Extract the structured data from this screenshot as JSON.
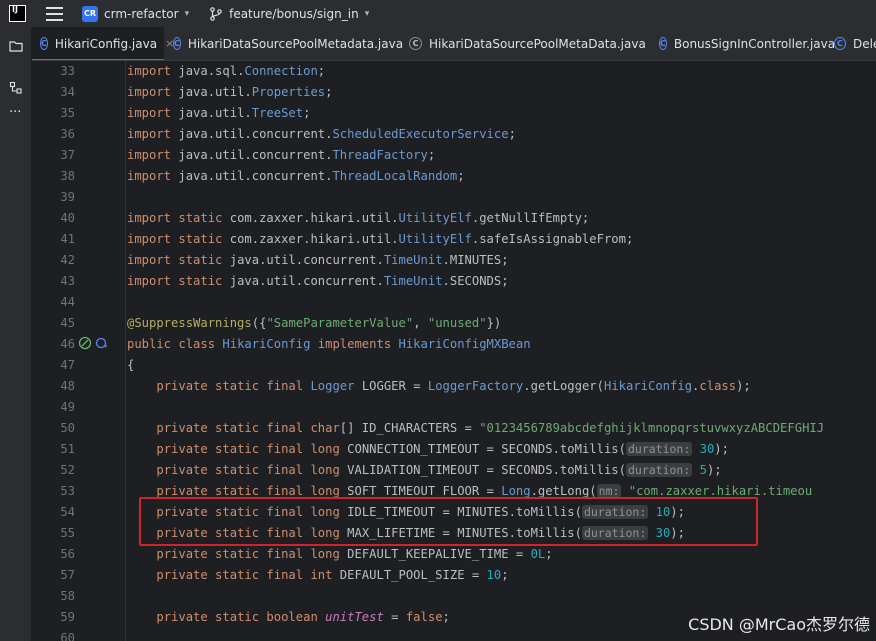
{
  "topbar": {
    "app_logo": "IJ",
    "project_badge": "CR",
    "project_name": "crm-refactor",
    "branch": "feature/bonus/sign_in"
  },
  "tabs": [
    {
      "label": "HikariConfig.java",
      "icon": "class-icon",
      "active": true
    },
    {
      "label": "HikariDataSourcePoolMetadata.java",
      "icon": "class-icon",
      "active": false
    },
    {
      "label": "HikariDataSourcePoolMetaData.java",
      "icon": "library-class-icon",
      "active": false
    },
    {
      "label": "BonusSignInController.java",
      "icon": "class-icon",
      "active": false
    },
    {
      "label": "Delet",
      "icon": "class-icon",
      "active": false
    }
  ],
  "code": {
    "lines": [
      {
        "n": "33",
        "t": [
          [
            "kw",
            "import "
          ],
          [
            "pkg",
            "java.sql."
          ],
          [
            "cls",
            "Connection"
          ],
          [
            "pkg",
            ";"
          ]
        ]
      },
      {
        "n": "34",
        "t": [
          [
            "kw",
            "import "
          ],
          [
            "pkg",
            "java.util."
          ],
          [
            "cls",
            "Properties"
          ],
          [
            "pkg",
            ";"
          ]
        ]
      },
      {
        "n": "35",
        "t": [
          [
            "kw",
            "import "
          ],
          [
            "pkg",
            "java.util."
          ],
          [
            "cls",
            "TreeSet"
          ],
          [
            "pkg",
            ";"
          ]
        ]
      },
      {
        "n": "36",
        "t": [
          [
            "kw",
            "import "
          ],
          [
            "pkg",
            "java.util.concurrent."
          ],
          [
            "cls",
            "ScheduledExecutorService"
          ],
          [
            "pkg",
            ";"
          ]
        ]
      },
      {
        "n": "37",
        "t": [
          [
            "kw",
            "import "
          ],
          [
            "pkg",
            "java.util.concurrent."
          ],
          [
            "cls",
            "ThreadFactory"
          ],
          [
            "pkg",
            ";"
          ]
        ]
      },
      {
        "n": "38",
        "t": [
          [
            "kw",
            "import "
          ],
          [
            "pkg",
            "java.util.concurrent."
          ],
          [
            "cls",
            "ThreadLocalRandom"
          ],
          [
            "pkg",
            ";"
          ]
        ]
      },
      {
        "n": "39",
        "t": []
      },
      {
        "n": "40",
        "t": [
          [
            "kw",
            "import static "
          ],
          [
            "pkg",
            "com.zaxxer.hikari.util."
          ],
          [
            "cls",
            "UtilityElf"
          ],
          [
            "pkg",
            ".getNullIfEmpty;"
          ]
        ]
      },
      {
        "n": "41",
        "t": [
          [
            "kw",
            "import static "
          ],
          [
            "pkg",
            "com.zaxxer.hikari.util."
          ],
          [
            "cls",
            "UtilityElf"
          ],
          [
            "pkg",
            ".safeIsAssignableFrom;"
          ]
        ]
      },
      {
        "n": "42",
        "t": [
          [
            "kw",
            "import static "
          ],
          [
            "pkg",
            "java.util.concurrent."
          ],
          [
            "cls",
            "TimeUnit"
          ],
          [
            "pkg",
            ".MINUTES;"
          ]
        ]
      },
      {
        "n": "43",
        "t": [
          [
            "kw",
            "import static "
          ],
          [
            "pkg",
            "java.util.concurrent."
          ],
          [
            "cls",
            "TimeUnit"
          ],
          [
            "pkg",
            ".SECONDS;"
          ]
        ]
      },
      {
        "n": "44",
        "t": []
      },
      {
        "n": "45",
        "t": [
          [
            "ann",
            "@SuppressWarnings"
          ],
          [
            "pkg",
            "({"
          ],
          [
            "str",
            "\"SameParameterValue\""
          ],
          [
            "pkg",
            ", "
          ],
          [
            "str",
            "\"unused\""
          ],
          [
            "pkg",
            "})"
          ]
        ]
      },
      {
        "n": "46",
        "t": [
          [
            "kw",
            "public class "
          ],
          [
            "cls",
            "HikariConfig "
          ],
          [
            "kw",
            "implements "
          ],
          [
            "cls",
            "HikariConfigMXBean"
          ]
        ],
        "gutter": true
      },
      {
        "n": "47",
        "t": [
          [
            "pkg",
            "{"
          ]
        ]
      },
      {
        "n": "48",
        "t": [
          [
            "pkg",
            "    "
          ],
          [
            "kw",
            "private static final "
          ],
          [
            "cls",
            "Logger "
          ],
          [
            "pkg",
            "LOGGER = "
          ],
          [
            "cls",
            "LoggerFactory"
          ],
          [
            "pkg",
            ".getLogger("
          ],
          [
            "cls",
            "HikariConfig"
          ],
          [
            "pkg",
            "."
          ],
          [
            "kw",
            "class"
          ],
          [
            "pkg",
            ");"
          ]
        ]
      },
      {
        "n": "49",
        "t": []
      },
      {
        "n": "50",
        "t": [
          [
            "pkg",
            "    "
          ],
          [
            "kw",
            "private static final char"
          ],
          [
            "pkg",
            "[] ID_CHARACTERS = "
          ],
          [
            "str",
            "\"0123456789abcdefghijklmnopqrstuvwxyzABCDEFGHIJ"
          ]
        ]
      },
      {
        "n": "51",
        "t": [
          [
            "pkg",
            "    "
          ],
          [
            "kw",
            "private static final long "
          ],
          [
            "pkg",
            "CONNECTION_TIMEOUT = SECONDS.toMillis("
          ],
          [
            "hint",
            "duration:"
          ],
          [
            "num",
            " 30"
          ],
          [
            "pkg",
            ");"
          ]
        ]
      },
      {
        "n": "52",
        "t": [
          [
            "pkg",
            "    "
          ],
          [
            "kw",
            "private static final long "
          ],
          [
            "pkg",
            "VALIDATION_TIMEOUT = SECONDS.toMillis("
          ],
          [
            "hint",
            "duration:"
          ],
          [
            "num",
            " 5"
          ],
          [
            "pkg",
            ");"
          ]
        ]
      },
      {
        "n": "53",
        "t": [
          [
            "pkg",
            "    "
          ],
          [
            "kw",
            "private static final long "
          ],
          [
            "pkg",
            "SOFT_TIMEOUT_FLOOR = "
          ],
          [
            "cls",
            "Long"
          ],
          [
            "pkg",
            ".getLong("
          ],
          [
            "hint",
            "nm:"
          ],
          [
            "str",
            " \"com.zaxxer.hikari.timeou"
          ]
        ]
      },
      {
        "n": "54",
        "t": [
          [
            "pkg",
            "    "
          ],
          [
            "kw",
            "private static final long "
          ],
          [
            "pkg",
            "IDLE_TIMEOUT = MINUTES.toMillis("
          ],
          [
            "hint",
            "duration:"
          ],
          [
            "num",
            " 10"
          ],
          [
            "pkg",
            ");"
          ]
        ]
      },
      {
        "n": "55",
        "t": [
          [
            "pkg",
            "    "
          ],
          [
            "kw",
            "private static final long "
          ],
          [
            "pkg",
            "MAX_LIFETIME = MINUTES.toMillis("
          ],
          [
            "hint",
            "duration:"
          ],
          [
            "num",
            " 30"
          ],
          [
            "pkg",
            ");"
          ]
        ]
      },
      {
        "n": "56",
        "t": [
          [
            "pkg",
            "    "
          ],
          [
            "kw",
            "private static final long "
          ],
          [
            "pkg",
            "DEFAULT_KEEPALIVE_TIME = "
          ],
          [
            "num",
            "0L"
          ],
          [
            "pkg",
            ";"
          ]
        ]
      },
      {
        "n": "57",
        "t": [
          [
            "pkg",
            "    "
          ],
          [
            "kw",
            "private static final int "
          ],
          [
            "pkg",
            "DEFAULT_POOL_SIZE = "
          ],
          [
            "num",
            "10"
          ],
          [
            "pkg",
            ";"
          ]
        ]
      },
      {
        "n": "58",
        "t": []
      },
      {
        "n": "59",
        "t": [
          [
            "pkg",
            "    "
          ],
          [
            "kw",
            "private static boolean "
          ],
          [
            "ital",
            "unitTest"
          ],
          [
            "pkg",
            " = "
          ],
          [
            "kw",
            "false"
          ],
          [
            "pkg",
            ";"
          ]
        ]
      },
      {
        "n": "60",
        "t": []
      }
    ]
  },
  "watermark": "CSDN @MrCao杰罗尔德"
}
